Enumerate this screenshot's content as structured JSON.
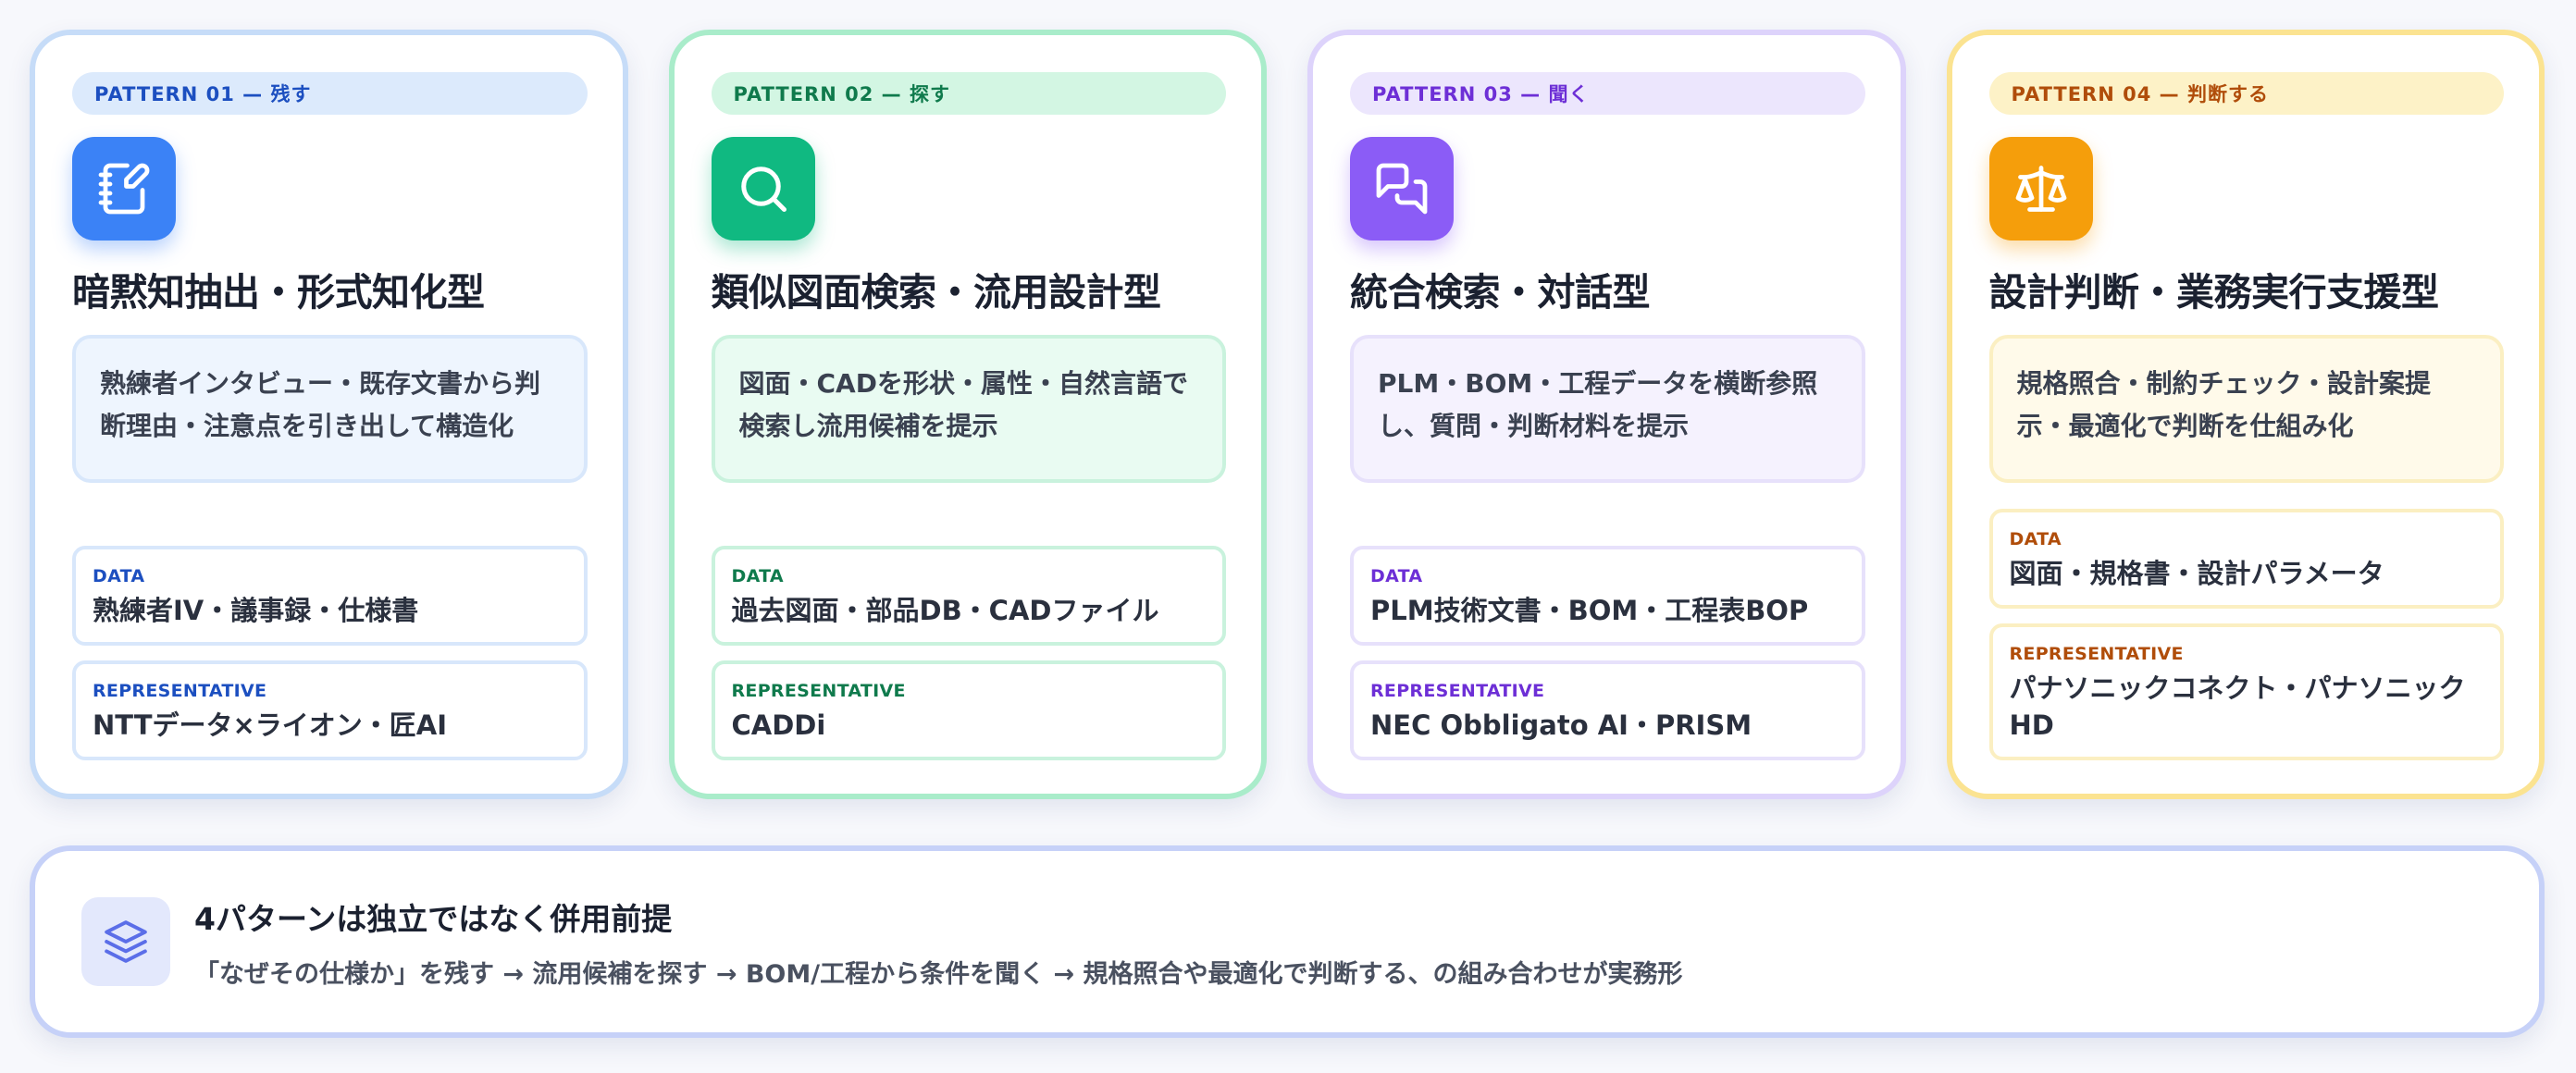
{
  "patterns": [
    {
      "tag": "PATTERN 01 — 残す",
      "icon": "notebook-pen-icon",
      "title": "暗黙知抽出・形式知化型",
      "description": [
        "熟練者インタビュー・既存文書から判",
        "断理由・注意点を引き出して構造化"
      ],
      "data_label": "DATA",
      "data_value": "熟練者IV・議事録・仕様書",
      "rep_label": "REPRESENTATIVE",
      "rep_value": [
        "NTTデータ×ライオン・匠AI"
      ],
      "accent": "#3b82f6"
    },
    {
      "tag": "PATTERN 02 — 探す",
      "icon": "search-icon",
      "title": "類似図面検索・流用設計型",
      "description": [
        "図面・CADを形状・属性・自然言語で",
        "検索し流用候補を提示"
      ],
      "data_label": "DATA",
      "data_value": "過去図面・部品DB・CADファイル",
      "rep_label": "REPRESENTATIVE",
      "rep_value": [
        "CADDi"
      ],
      "accent": "#10b981"
    },
    {
      "tag": "PATTERN 03 — 聞く",
      "icon": "chat-bubbles-icon",
      "title": "統合検索・対話型",
      "description": [
        "PLM・BOM・工程データを横断参照",
        "し、質問・判断材料を提示"
      ],
      "data_label": "DATA",
      "data_value": "PLM技術文書・BOM・工程表BOP",
      "rep_label": "REPRESENTATIVE",
      "rep_value": [
        "NEC Obbligato AI・PRISM"
      ],
      "accent": "#8b5cf6"
    },
    {
      "tag": "PATTERN 04 — 判断する",
      "icon": "scale-icon",
      "title": "設計判断・業務実行支援型",
      "description": [
        "規格照合・制約チェック・設計案提",
        "示・最適化で判断を仕組み化"
      ],
      "data_label": "DATA",
      "data_value": "図面・規格書・設計パラメータ",
      "rep_label": "REPRESENTATIVE",
      "rep_value": [
        "パナソニックコネクト・パナソニック",
        "HD"
      ],
      "accent": "#f59e0b"
    }
  ],
  "summary": {
    "icon": "layers-icon",
    "title": "4パターンは独立ではなく併用前提",
    "description": "「なぜその仕様か」を残す → 流用候補を探す → BOM/工程から条件を聞く → 規格照合や最適化で判断する、の組み合わせが実務形"
  }
}
